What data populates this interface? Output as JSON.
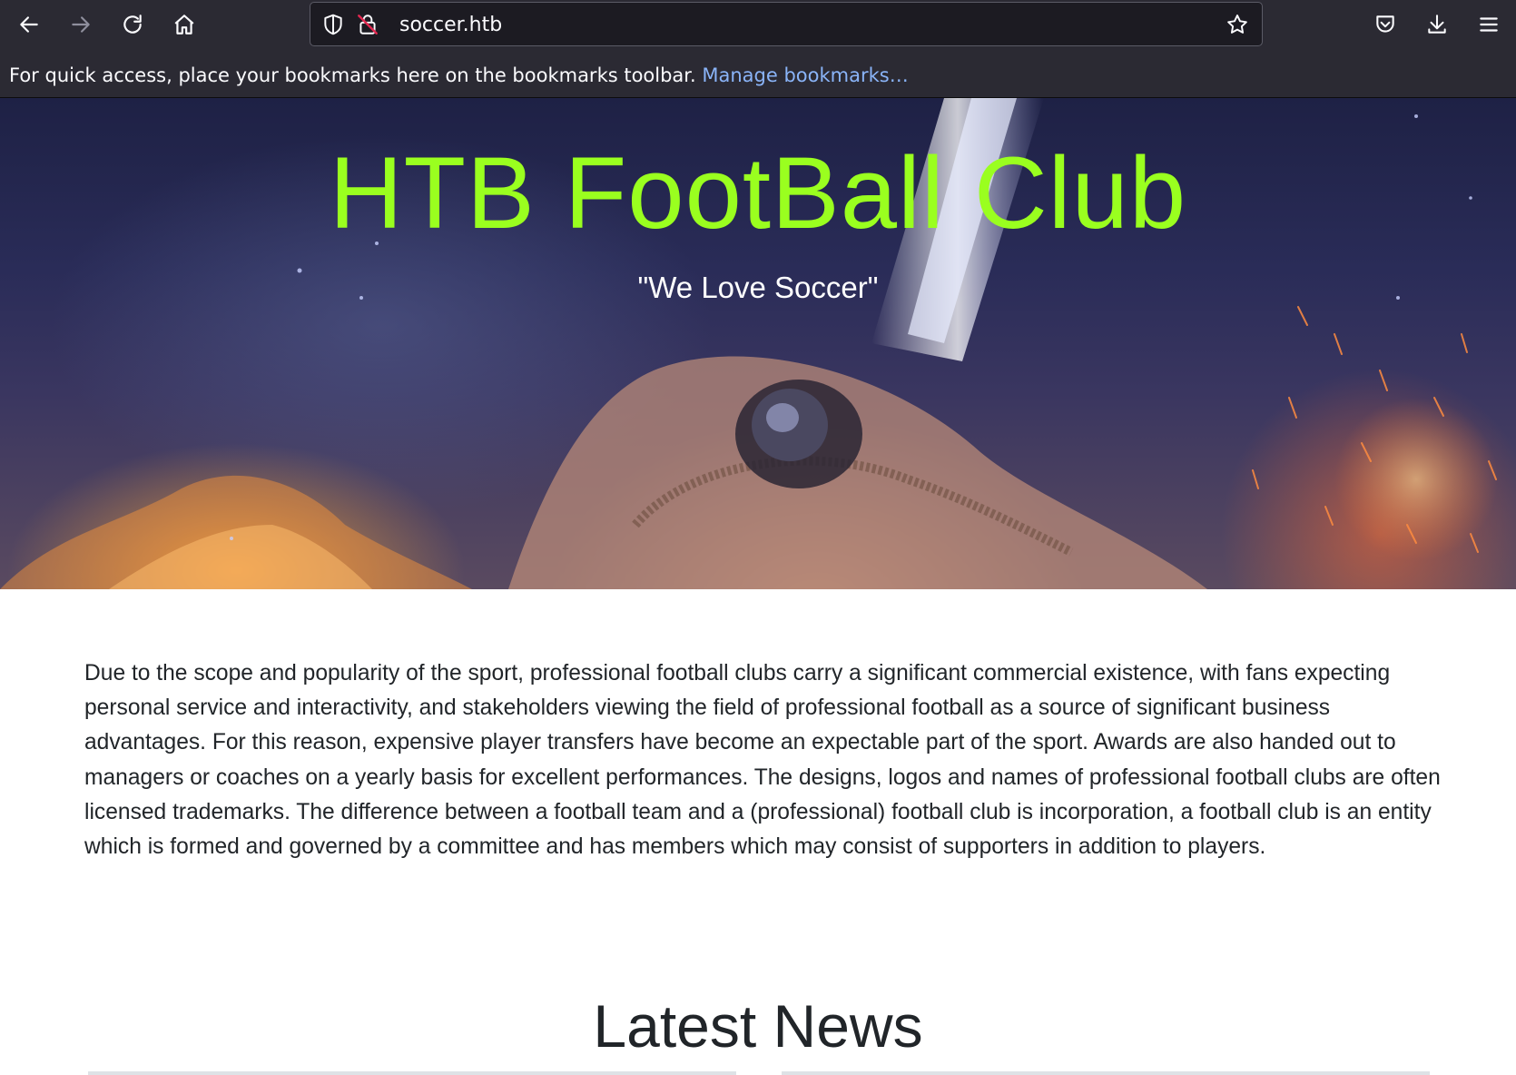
{
  "browser": {
    "url": "soccer.htb",
    "bookmarks_bar": {
      "message": "For quick access, place your bookmarks here on the bookmarks toolbar.",
      "manage_link": "Manage bookmarks…"
    },
    "icons": [
      "back-icon",
      "forward-icon",
      "reload-icon",
      "home-icon",
      "shield-icon",
      "insecure-lock-icon",
      "bookmark-star-icon",
      "pocket-icon",
      "downloads-icon",
      "menu-icon"
    ]
  },
  "hero": {
    "title": "HTB FootBall Club",
    "subtitle": "\"We Love Soccer\"",
    "title_color": "#9aff1f"
  },
  "main": {
    "intro_paragraph": "Due to the scope and popularity of the sport, professional football clubs carry a significant commercial existence, with fans expecting personal service and interactivity, and stakeholders viewing the field of professional football as a source of significant business advantages. For this reason, expensive player transfers have become an expectable part of the sport. Awards are also handed out to managers or coaches on a yearly basis for excellent performances. The designs, logos and names of professional football clubs are often licensed trademarks. The difference between a football team and a (professional) football club is incorporation, a football club is an entity which is formed and governed by a committee and has members which may consist of supporters in addition to players.",
    "news_heading": "Latest News"
  }
}
